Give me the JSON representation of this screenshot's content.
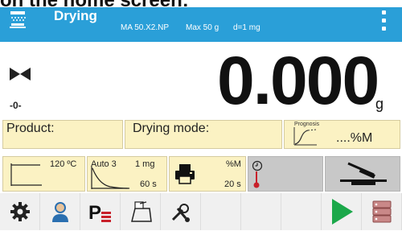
{
  "caption": "on the home screen:",
  "header": {
    "title": "Drying",
    "icon": "drying-lamp-icon",
    "model": "MA 50.X2.NP",
    "max": "Max 50 g",
    "division": "d=1 mg",
    "menu_icon": "kebab-menu-icon",
    "color": "#2a9fd8"
  },
  "weighing": {
    "stability_icon": "stable-indicator-icon",
    "zero_indicator": "-0-",
    "mass": "0.000",
    "unit": "g"
  },
  "info": {
    "product_label": "Product:",
    "drying_mode_label": "Drying mode:",
    "prognosis_label": "Prognosis",
    "prognosis_value": "....%M"
  },
  "tiles": {
    "profile_temp": "120 ºC",
    "finish_mode": "Auto 3",
    "finish_mass": "1 mg",
    "finish_time": "60 s",
    "print_unit": "%M",
    "print_interval": "20 s"
  },
  "toolbar": {
    "icons": [
      "settings-gear-icon",
      "user-icon",
      "product-database-icon",
      "calibration-scale-icon",
      "tools-icon",
      "empty",
      "empty",
      "empty",
      "start-play-icon",
      "database-icon"
    ]
  },
  "colors": {
    "accent": "#2a9fd8",
    "tile_bg": "#fbf2c3",
    "play_green": "#1ba84a",
    "thermo_red": "#c8202a"
  }
}
